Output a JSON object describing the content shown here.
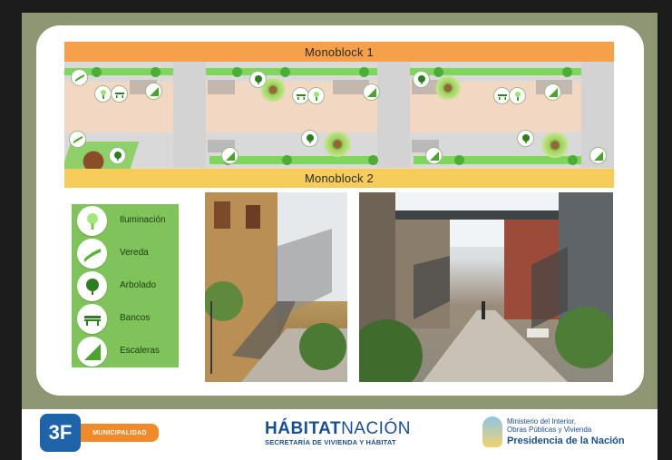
{
  "plan": {
    "top_block_label": "Monoblock 1",
    "bottom_block_label": "Monoblock 2"
  },
  "legend": {
    "items": [
      {
        "label": "Iluminación",
        "icon": "lamp-icon"
      },
      {
        "label": "Vereda",
        "icon": "path-icon"
      },
      {
        "label": "Arbolado",
        "icon": "tree-icon"
      },
      {
        "label": "Bancos",
        "icon": "bench-icon"
      },
      {
        "label": "Escaleras",
        "icon": "stairs-icon"
      }
    ]
  },
  "footer": {
    "logo_text": "3F",
    "municipality_label": "MUNICIPALIDAD",
    "habitat_title_bold": "HÁBITAT",
    "habitat_title_regular": "NACIÓN",
    "habitat_subtitle": "SECRETARÍA DE VIVIENDA Y HÁBITAT",
    "ministry_line1": "Ministerio del Interior,",
    "ministry_line2": "Obras Públicas y Vivienda",
    "ministry_line3": "Presidencia de la Nación"
  },
  "colors": {
    "olive_frame": "#8e9673",
    "monoblock1": "#f5a04a",
    "monoblock2": "#f6cc5b",
    "legend_bg": "#7fc35a",
    "brand_blue": "#1a4f8f",
    "brand_orange": "#f08a2a"
  }
}
